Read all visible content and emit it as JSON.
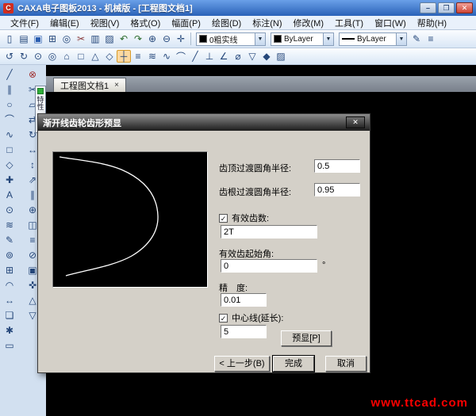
{
  "titlebar": {
    "app_icon": "C",
    "title": "CAXA电子图板2013 - 机械版 - [工程图文档1]",
    "minimize": "–",
    "maximize": "❐",
    "close": "✕"
  },
  "menubar": {
    "items": [
      "文件(F)",
      "编辑(E)",
      "视图(V)",
      "格式(O)",
      "幅面(P)",
      "绘图(D)",
      "标注(N)",
      "修改(M)",
      "工具(T)",
      "窗口(W)",
      "帮助(H)"
    ]
  },
  "toolbar_top": {
    "icons": [
      {
        "g": "▯",
        "n": "new-file-icon"
      },
      {
        "g": "▤",
        "n": "open-file-icon"
      },
      {
        "g": "▣",
        "n": "save-icon",
        "c": "#2a5db0"
      },
      {
        "g": "⊞",
        "n": "print-icon"
      },
      {
        "g": "◎",
        "n": "print-preview-icon"
      },
      {
        "g": "✂",
        "n": "cut-icon",
        "c": "#8a3a3a"
      },
      {
        "g": "▥",
        "n": "copy-icon"
      },
      {
        "g": "▨",
        "n": "paste-icon"
      },
      {
        "g": "↶",
        "n": "undo-icon",
        "c": "#2a6a2a"
      },
      {
        "g": "↷",
        "n": "redo-icon",
        "c": "#2a6a2a"
      },
      {
        "g": "⊕",
        "n": "zoom-in-icon"
      },
      {
        "g": "⊖",
        "n": "zoom-out-icon"
      },
      {
        "g": "✛",
        "n": "pan-icon"
      }
    ],
    "layer_combo": {
      "value": "0粗实线",
      "arrow": "▼"
    },
    "color_combo": {
      "value": "ByLayer",
      "arrow": "▼"
    },
    "linetype_combo": {
      "value": "ByLayer",
      "arrow": "▼"
    },
    "icons_right": [
      {
        "g": "✎",
        "n": "edit-style-icon"
      },
      {
        "g": "≡",
        "n": "format-painter-icon"
      }
    ]
  },
  "toolbar_second": {
    "icons": [
      {
        "g": "↺",
        "n": "refresh-view-icon"
      },
      {
        "g": "↻",
        "n": "redraw-icon"
      },
      {
        "g": "⊙",
        "n": "zoom-extents-icon"
      },
      {
        "g": "◎",
        "n": "zoom-window-icon"
      },
      {
        "g": "⌂",
        "n": "home-view-icon"
      },
      {
        "g": "□",
        "n": "new-view-icon"
      },
      {
        "g": "△",
        "n": "triangle-tool-icon"
      },
      {
        "g": "◇",
        "n": "polygon-tool-icon"
      },
      {
        "g": "┼",
        "n": "crosshair-tool-icon",
        "a": true
      },
      {
        "g": "≡",
        "n": "layer-manager-icon"
      },
      {
        "g": "≋",
        "n": "hatch-icon"
      },
      {
        "g": "∿",
        "n": "spline-tool-icon"
      },
      {
        "g": "⌒",
        "n": "arc-tool-icon"
      },
      {
        "g": "╱",
        "n": "line-tool-icon"
      },
      {
        "g": "⊥",
        "n": "perpendicular-icon"
      },
      {
        "g": "∠",
        "n": "angle-dimension-icon"
      },
      {
        "g": "⌀",
        "n": "diameter-dimension-icon"
      },
      {
        "g": "▽",
        "n": "datum-icon"
      },
      {
        "g": "◆",
        "n": "diamond-tool-icon"
      },
      {
        "g": "▨",
        "n": "pattern-fill-icon"
      }
    ]
  },
  "left_toolbar_outer": {
    "icons": [
      {
        "g": "╱",
        "n": "line-icon"
      },
      {
        "g": "∥",
        "n": "parallel-line-icon"
      },
      {
        "g": "○",
        "n": "circle-icon"
      },
      {
        "g": "⌒",
        "n": "arc-icon"
      },
      {
        "g": "∿",
        "n": "spline-icon"
      },
      {
        "g": "□",
        "n": "rectangle-icon"
      },
      {
        "g": "◇",
        "n": "polygon-icon"
      },
      {
        "g": "✚",
        "n": "point-icon"
      },
      {
        "g": "A",
        "n": "text-icon"
      },
      {
        "g": "⊙",
        "n": "center-circle-icon"
      },
      {
        "g": "≋",
        "n": "hatch-fill-icon"
      },
      {
        "g": "✎",
        "n": "sketch-icon"
      },
      {
        "g": "⊚",
        "n": "position-icon"
      },
      {
        "g": "⊞",
        "n": "grid-icon"
      },
      {
        "g": "◠",
        "n": "three-point-arc-icon"
      },
      {
        "g": "↔",
        "n": "linear-dimension-icon"
      },
      {
        "g": "❏",
        "n": "block-icon"
      },
      {
        "g": "✱",
        "n": "star-icon"
      },
      {
        "g": "▭",
        "n": "wide-rect-icon"
      }
    ]
  },
  "left_toolbar_inner": {
    "icons": [
      {
        "g": "⊗",
        "n": "delete-icon",
        "c": "#a03030"
      },
      {
        "g": "✂",
        "n": "trim-icon"
      },
      {
        "g": "▱",
        "n": "offset-icon"
      },
      {
        "g": "⇄",
        "n": "mirror-icon"
      },
      {
        "g": "↻",
        "n": "rotate-icon"
      },
      {
        "g": "↔",
        "n": "stretch-icon"
      },
      {
        "g": "↕",
        "n": "scale-vertical-icon"
      },
      {
        "g": "⇗",
        "n": "move-icon"
      },
      {
        "g": "∥",
        "n": "array-icon"
      },
      {
        "g": "⊕",
        "n": "copy-object-icon"
      },
      {
        "g": "◫",
        "n": "explode-icon"
      },
      {
        "g": "≡",
        "n": "properties-icon"
      },
      {
        "g": "⊘",
        "n": "break-icon"
      },
      {
        "g": "▣",
        "n": "fillet-icon"
      },
      {
        "g": "✜",
        "n": "chamfer-icon"
      },
      {
        "g": "△",
        "n": "scale-icon"
      },
      {
        "g": "▽",
        "n": "align-icon"
      }
    ]
  },
  "palette_tab": {
    "label": "特性"
  },
  "document_tab": {
    "label": "工程图文档1",
    "close": "×"
  },
  "dialog": {
    "title": "渐开线齿轮齿形预显",
    "close": "✕",
    "checkbox_glyph": "✓",
    "fields": {
      "tip_fillet_label": "齿顶过渡圆角半径:",
      "tip_fillet_value": "0.5",
      "root_fillet_label": "齿根过渡圆角半径:",
      "root_fillet_value": "0.95",
      "effective_teeth_label": "有效齿数:",
      "effective_teeth_value": "2T",
      "start_angle_label": "有效齿起始角:",
      "start_angle_value": "0",
      "degree_symbol": "°",
      "precision_label": "精　度:",
      "precision_value": "0.01",
      "centerline_label": "中心线(延长):",
      "centerline_value": "5"
    },
    "buttons": {
      "preview": "预显[P]",
      "back": "< 上一步(B)",
      "finish": "完成",
      "cancel": "取消"
    }
  },
  "watermark": "www.ttcad.com",
  "colors": {
    "titlebar_blue": "#2a62b8",
    "canvas": "#000000",
    "dialog_bg": "#d4d0c8",
    "watermark_red": "#ff0000",
    "active_tool_highlight": "#fcd9a0"
  }
}
